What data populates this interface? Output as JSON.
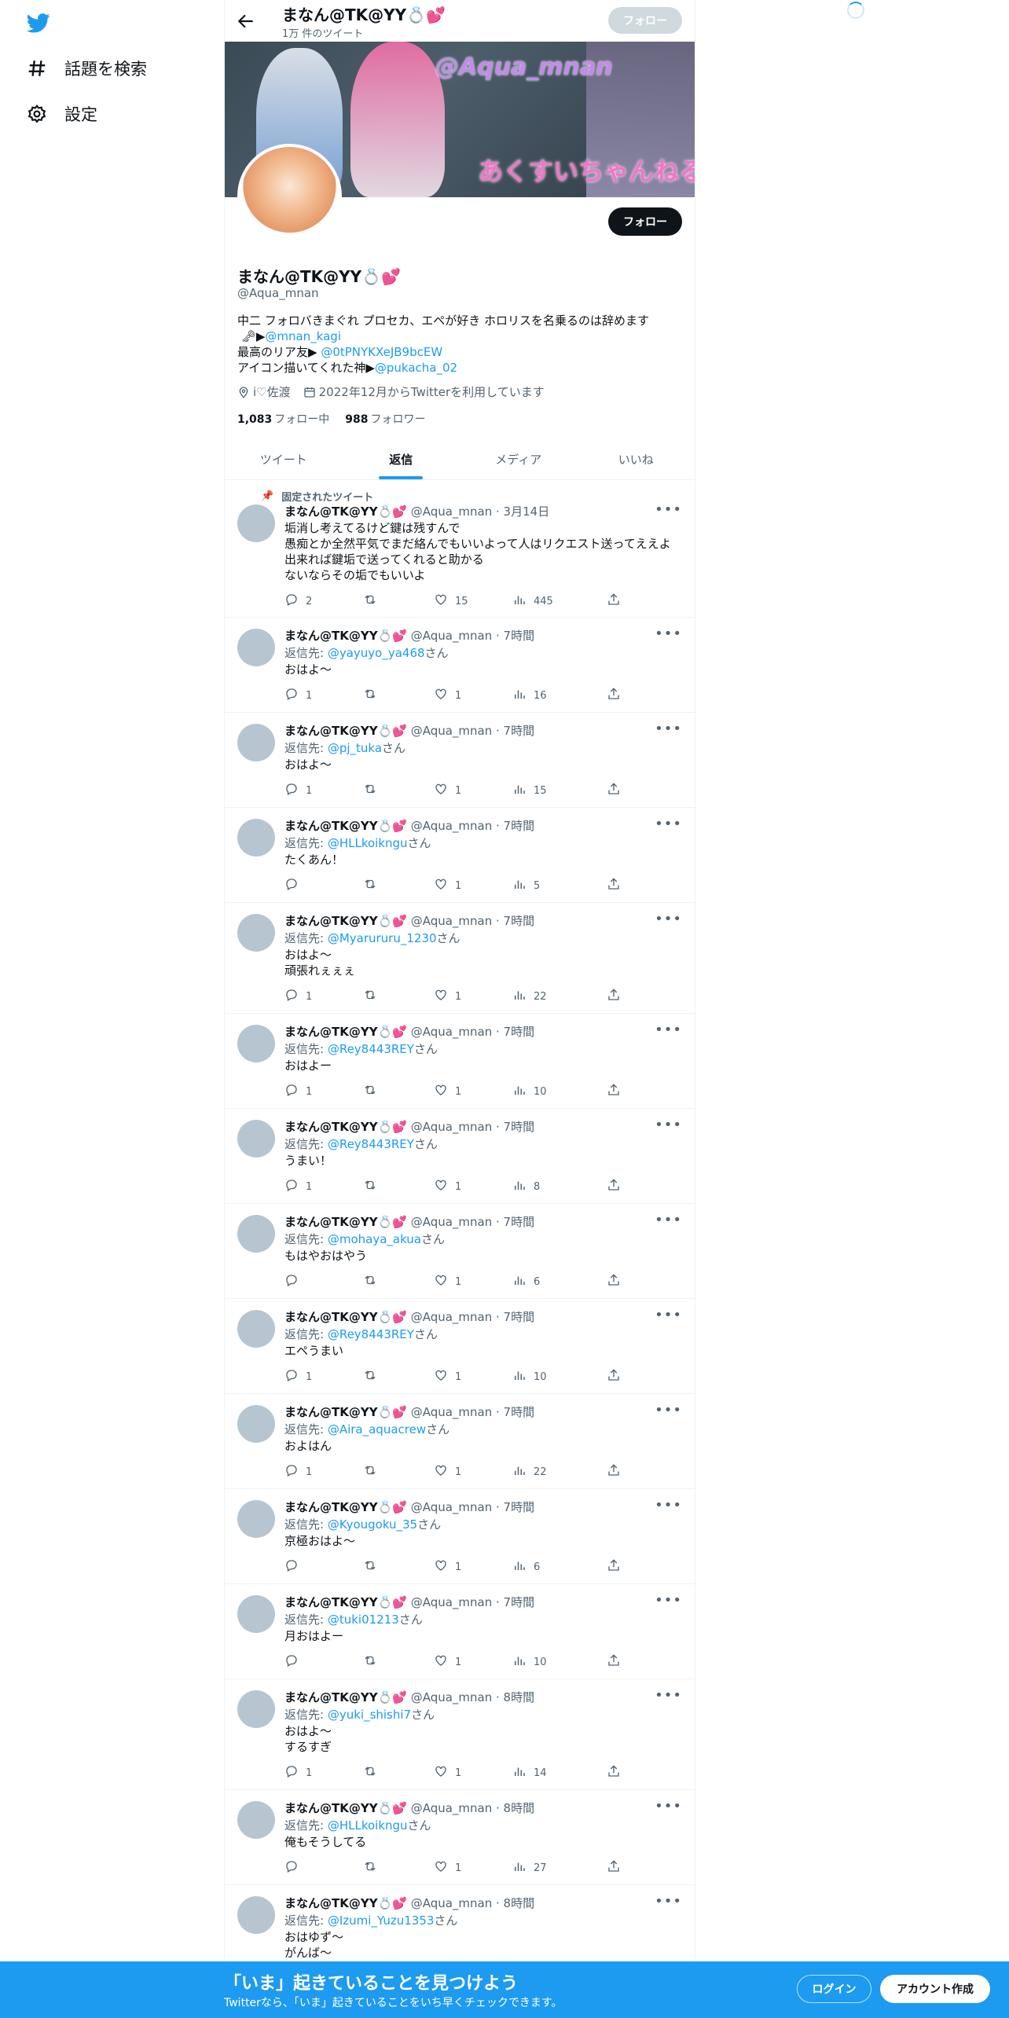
{
  "colors": {
    "accent": "#1d9bf0",
    "text": "#0f1419",
    "muted": "#536471",
    "bottom_bar": "#1d9bf0"
  },
  "nav": {
    "logo": "twitter-bird-icon",
    "items": [
      {
        "label": "話題を検索",
        "icon": "hashtag-icon"
      },
      {
        "label": "設定",
        "icon": "gear-icon"
      }
    ]
  },
  "header": {
    "name": "まなん@TK@YY💍💕",
    "tweet_count": "1万 件のツイート",
    "follow_label": "フォロー"
  },
  "banner": {
    "handle_text": "@Aqua_mnan",
    "jp_text": "あくすいちゃんねる"
  },
  "profile": {
    "name": "まなん@TK@YY💍💕",
    "handle": "@Aqua_mnan",
    "follow_label": "フォロー",
    "bio": {
      "line1": "中二 フォロバきまぐれ プロセカ、エペが好き ホロリスを名乗るのは辞めます",
      "line2_prefix": "🗝▶",
      "line2_link": "@mnan_kagi",
      "line3_prefix": "最高のリア友▶ ",
      "line3_link": "@0tPNYKXeJB9bcEW",
      "line4_prefix": "アイコン描いてくれた神▶",
      "line4_link": "@pukacha_02"
    },
    "location": "i♡佐渡",
    "joined": "2022年12月からTwitterを利用しています",
    "following_count": "1,083",
    "following_label": "フォロー中",
    "followers_count": "988",
    "followers_label": "フォロワー"
  },
  "tabs": [
    "ツイート",
    "返信",
    "メディア",
    "いいね"
  ],
  "pinned_label": "固定されたツイート",
  "reply_prefix": "返信先: ",
  "reply_suffix": "さん",
  "tweets": [
    {
      "name": "まなん@TK@YY💍💕",
      "meta": "@Aqua_mnan · 3月14日",
      "reply_to": "",
      "lines": [
        "垢消し考えてるけど鍵は残すんで",
        "愚痴とか全然平気でまだ絡んでもいいよって人はリクエスト送ってええよ",
        "出来れば鍵垢で送ってくれると助かる",
        "ないならその垢でもいいよ"
      ],
      "replies": "2",
      "likes": "15",
      "views": "445"
    },
    {
      "name": "まなん@TK@YY💍💕",
      "meta": "@Aqua_mnan · 7時間",
      "reply_to": "@yayuyo_ya468",
      "lines": [
        "おはよ〜"
      ],
      "replies": "1",
      "likes": "1",
      "views": "16"
    },
    {
      "name": "まなん@TK@YY💍💕",
      "meta": "@Aqua_mnan · 7時間",
      "reply_to": "@pj_tuka",
      "lines": [
        "おはよ〜"
      ],
      "replies": "1",
      "likes": "1",
      "views": "15"
    },
    {
      "name": "まなん@TK@YY💍💕",
      "meta": "@Aqua_mnan · 7時間",
      "reply_to": "@HLLkoikngu",
      "lines": [
        "たくあん！"
      ],
      "replies": "",
      "likes": "1",
      "views": "5"
    },
    {
      "name": "まなん@TK@YY💍💕",
      "meta": "@Aqua_mnan · 7時間",
      "reply_to": "@Myarururu_1230",
      "lines": [
        "おはよ〜",
        "頑張れぇぇぇ"
      ],
      "replies": "1",
      "likes": "1",
      "views": "22"
    },
    {
      "name": "まなん@TK@YY💍💕",
      "meta": "@Aqua_mnan · 7時間",
      "reply_to": "@Rey8443REY",
      "lines": [
        "おはよー"
      ],
      "replies": "1",
      "likes": "1",
      "views": "10"
    },
    {
      "name": "まなん@TK@YY💍💕",
      "meta": "@Aqua_mnan · 7時間",
      "reply_to": "@Rey8443REY",
      "lines": [
        "うまい！"
      ],
      "replies": "1",
      "likes": "1",
      "views": "8"
    },
    {
      "name": "まなん@TK@YY💍💕",
      "meta": "@Aqua_mnan · 7時間",
      "reply_to": "@mohaya_akua",
      "lines": [
        "もはやおはやう"
      ],
      "replies": "",
      "likes": "1",
      "views": "6"
    },
    {
      "name": "まなん@TK@YY💍💕",
      "meta": "@Aqua_mnan · 7時間",
      "reply_to": "@Rey8443REY",
      "lines": [
        "エペうまい"
      ],
      "replies": "1",
      "likes": "1",
      "views": "10"
    },
    {
      "name": "まなん@TK@YY💍💕",
      "meta": "@Aqua_mnan · 7時間",
      "reply_to": "@Aira_aquacrew",
      "lines": [
        "およはん"
      ],
      "replies": "1",
      "likes": "1",
      "views": "22"
    },
    {
      "name": "まなん@TK@YY💍💕",
      "meta": "@Aqua_mnan · 7時間",
      "reply_to": "@Kyougoku_35",
      "lines": [
        "京極おはよ〜"
      ],
      "replies": "",
      "likes": "1",
      "views": "6"
    },
    {
      "name": "まなん@TK@YY💍💕",
      "meta": "@Aqua_mnan · 7時間",
      "reply_to": "@tuki01213",
      "lines": [
        "月おはよー"
      ],
      "replies": "",
      "likes": "1",
      "views": "10"
    },
    {
      "name": "まなん@TK@YY💍💕",
      "meta": "@Aqua_mnan · 8時間",
      "reply_to": "@yuki_shishi7",
      "lines": [
        "おはよ〜",
        "するすぎ"
      ],
      "replies": "1",
      "likes": "1",
      "views": "14"
    },
    {
      "name": "まなん@TK@YY💍💕",
      "meta": "@Aqua_mnan · 8時間",
      "reply_to": "@HLLkoikngu",
      "lines": [
        "俺もそうしてる"
      ],
      "replies": "",
      "likes": "1",
      "views": "27"
    },
    {
      "name": "まなん@TK@YY💍💕",
      "meta": "@Aqua_mnan · 8時間",
      "reply_to": "@Izumi_Yuzu1353",
      "lines": [
        "おはゆず〜",
        "がんば〜"
      ],
      "replies": "",
      "likes": "",
      "views": ""
    }
  ],
  "bottom_bar": {
    "title": "「いま」起きていることを見つけよう",
    "subtitle": "Twitterなら、「いま」起きていることをいち早くチェックできます。",
    "login_label": "ログイン",
    "signup_label": "アカウント作成"
  }
}
